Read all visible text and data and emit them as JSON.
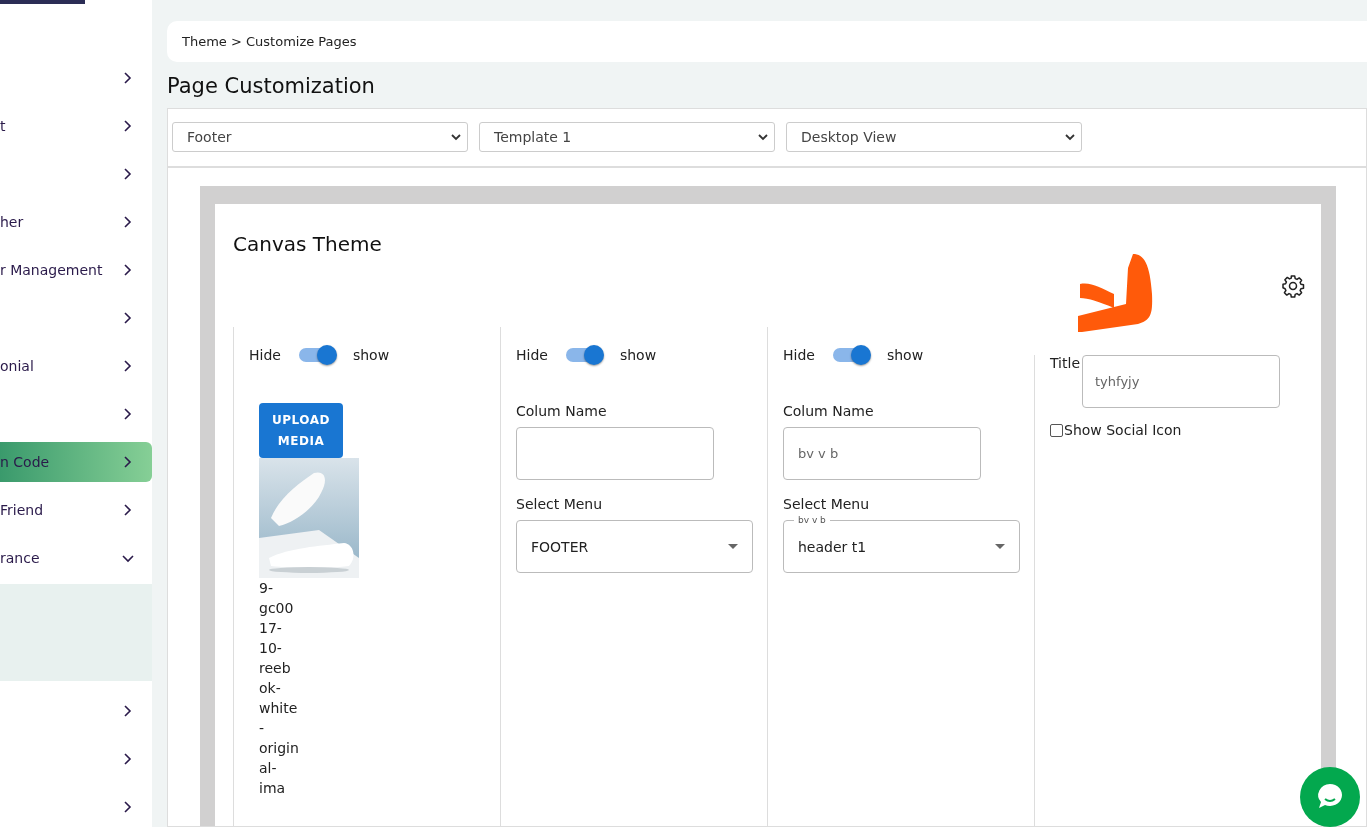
{
  "sidebar": {
    "items": [
      {
        "selected": false,
        "expanded": false
      },
      {
        "label": "t",
        "selected": false,
        "expanded": false
      },
      {
        "selected": false,
        "expanded": false
      },
      {
        "label": "her",
        "selected": false,
        "expanded": false
      },
      {
        "label": "r Management",
        "selected": false,
        "expanded": false
      },
      {
        "selected": false,
        "expanded": false
      },
      {
        "label": "onial",
        "selected": false,
        "expanded": false
      },
      {
        "selected": false,
        "expanded": false
      },
      {
        "label": "n Code",
        "selected": true,
        "expanded": false
      },
      {
        "label": "Friend",
        "selected": false,
        "expanded": false
      },
      {
        "label": "rance",
        "selected": false,
        "expanded": true
      },
      {
        "selected": false,
        "expanded": false
      },
      {
        "selected": false,
        "expanded": false
      },
      {
        "selected": false,
        "expanded": false
      }
    ]
  },
  "breadcrumb": "Theme > Customize Pages",
  "page_title": "Page Customization",
  "filters": [
    {
      "value": "Footer"
    },
    {
      "value": "Template 1"
    },
    {
      "value": "Desktop View"
    }
  ],
  "canvas": {
    "title": "Canvas Theme",
    "columns": [
      {
        "kind": "media",
        "hide_label": "Hide",
        "show_label": "show",
        "on": true,
        "button": "UPLOAD MEDIA",
        "file_name": "9-gc0017-10-reebok-white-original-ima"
      },
      {
        "kind": "menu",
        "hide_label": "Hide",
        "show_label": "show",
        "on": true,
        "name_label": "Colum Name",
        "menu_label": "Select Menu",
        "menu_value": "FOOTER"
      },
      {
        "kind": "menu",
        "hide_label": "Hide",
        "show_label": "show",
        "on": true,
        "name_label": "Colum Name",
        "name_value": "bv v b",
        "menu_label": "Select Menu",
        "menu_float": "bv v b",
        "menu_value": "header t1"
      },
      {
        "kind": "title",
        "title_label": "Title",
        "title_value": "tyhfyjy",
        "checkbox_label": "Show Social Icon",
        "checked": false
      }
    ]
  }
}
